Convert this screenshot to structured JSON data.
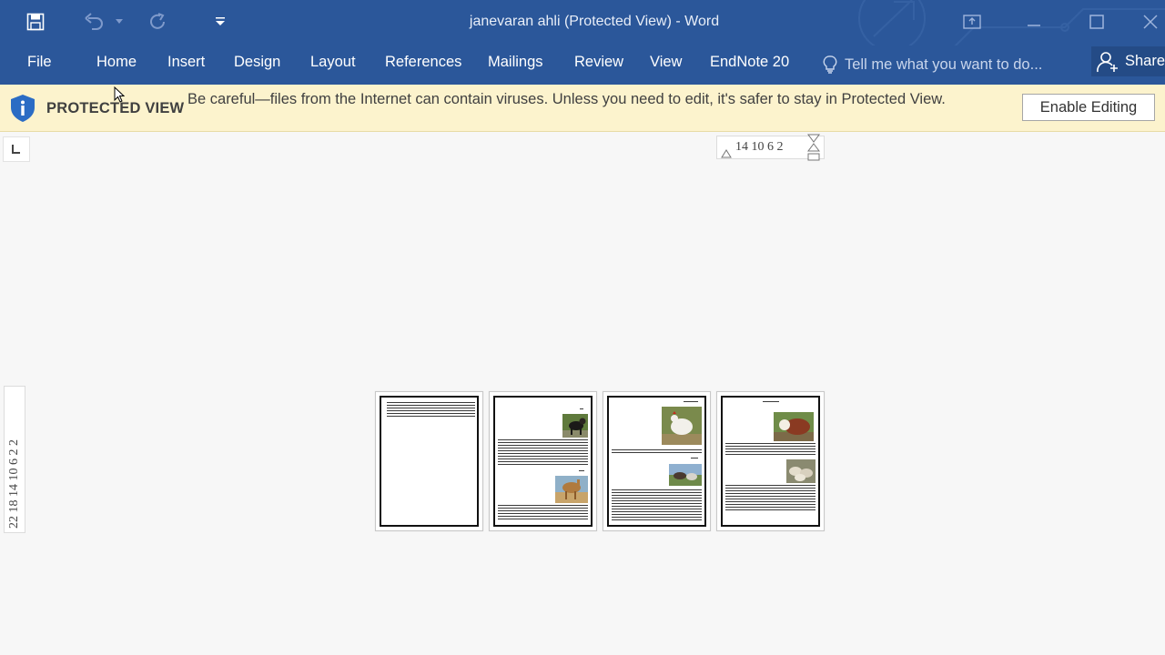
{
  "window": {
    "title": "janevaran ahli (Protected View) - Word"
  },
  "ribbon": {
    "tabs": [
      "File",
      "Home",
      "Insert",
      "Design",
      "Layout",
      "References",
      "Mailings",
      "Review",
      "View",
      "EndNote 20"
    ],
    "tell_me_placeholder": "Tell me what you want to do...",
    "share_label": "Share"
  },
  "protected_view": {
    "title": "PROTECTED VIEW",
    "message": "Be careful—files from the Internet can contain viruses. Unless you need to edit, it's safer to stay in Protected View.",
    "enable_button": "Enable Editing"
  },
  "rulers": {
    "horizontal": "14  10   6    2",
    "vertical": "22 18 14 10  6   2    2"
  },
  "colors": {
    "ribbon_bg": "#2b579a",
    "protected_bar_bg": "#fcf3cd",
    "canvas_bg": "#f7f7f7"
  }
}
